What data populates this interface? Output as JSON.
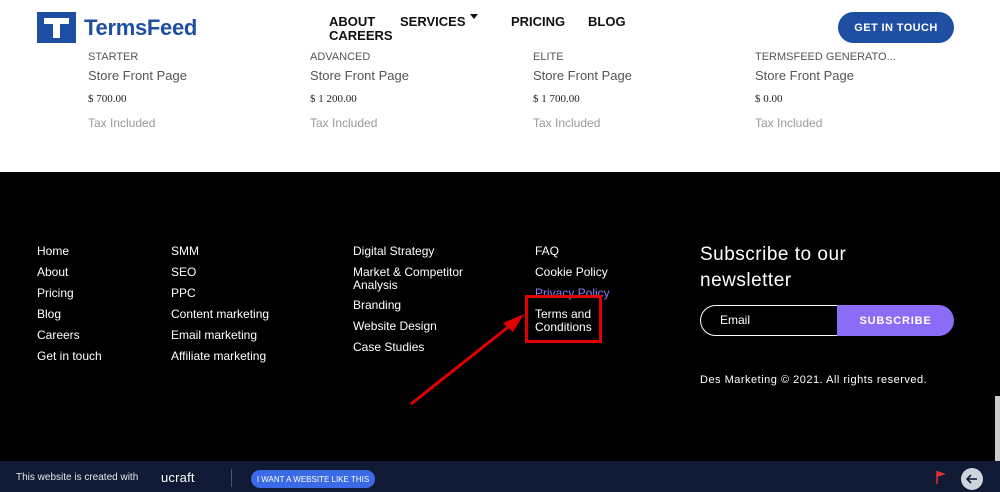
{
  "header": {
    "logo_text": "TermsFeed",
    "nav": {
      "about": "ABOUT",
      "services": "SERVICES",
      "pricing": "PRICING",
      "blog": "BLOG",
      "careers": "CAREERS"
    },
    "cta_label": "GET IN TOUCH",
    "brand_color": "#1f4fa3"
  },
  "pricing": {
    "plans": [
      {
        "name": "STARTER",
        "type": "Store Front Page",
        "price": "$ 700.00",
        "tax": "Tax Included"
      },
      {
        "name": "ADVANCED",
        "type": "Store Front Page",
        "price": "$ 1 200.00",
        "tax": "Tax Included"
      },
      {
        "name": "ELITE",
        "type": "Store Front Page",
        "price": "$ 1 700.00",
        "tax": "Tax Included"
      },
      {
        "name": "TERMSFEED GENERATO...",
        "type": "Store Front Page",
        "price": "$ 0.00",
        "tax": "Tax Included"
      }
    ]
  },
  "footer": {
    "col1": [
      "Home",
      "About",
      "Pricing",
      "Blog",
      "Careers",
      "Get in touch"
    ],
    "col2": [
      "SMM",
      "SEO",
      "PPC",
      "Content marketing",
      "Email marketing",
      "Affiliate marketing"
    ],
    "col3": [
      "Digital Strategy",
      "Market & Competitor Analysis",
      "Branding",
      "Website Design",
      "Case Studies"
    ],
    "col4": [
      "FAQ",
      "Cookie Policy",
      "Privacy Policy",
      "Terms and Conditions"
    ],
    "newsletter_title": "Subscribe to our newsletter",
    "email_placeholder": "Email",
    "subscribe_label": "SUBSCRIBE",
    "copyright": "Des Marketing © 2021. All rights reserved.",
    "accent_color": "#8b6cf6",
    "highlight_color": "#e00000"
  },
  "bottombar": {
    "text": "This website is created with",
    "brand": "ucraft",
    "cta_label": "I WANT A WEBSITE LIKE THIS",
    "flag_icon": "flag-icon",
    "back_icon": "arrow-left-icon"
  }
}
